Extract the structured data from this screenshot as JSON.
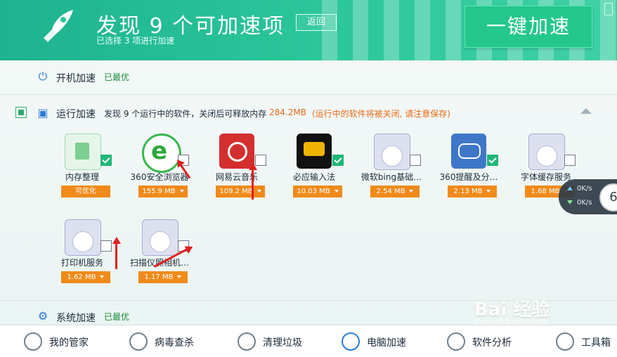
{
  "header": {
    "title": "发现 9 个可加速项",
    "subtitle": "已选择 3 项进行加速",
    "back_label": "返回",
    "accelerate_label": "一键加速"
  },
  "startup": {
    "title": "开机加速",
    "status": "已最优"
  },
  "running": {
    "title": "运行加速",
    "desc": "发现 9 个运行中的软件，关闭后可释放内存",
    "size": "284.2MB",
    "warning": "(运行中的软件将被关闭, 请注意保存)"
  },
  "apps": [
    {
      "label": "内存整理",
      "badge": "可优化",
      "checked": true,
      "icon": "memory-chip-icon"
    },
    {
      "label": "360安全浏览器",
      "badge": "155.9 MB",
      "checked": false,
      "icon": "ie-browser-icon"
    },
    {
      "label": "网易云音乐",
      "badge": "109.2 MB",
      "checked": false,
      "icon": "netease-music-icon"
    },
    {
      "label": "必应输入法",
      "badge": "10.03 MB",
      "checked": true,
      "icon": "bing-input-icon"
    },
    {
      "label": "微软bing基础…",
      "badge": "2.54 MB",
      "checked": false,
      "icon": "disc-service-icon"
    },
    {
      "label": "360提醒及分…",
      "badge": "2.13 MB",
      "checked": true,
      "icon": "chat-bubble-icon"
    },
    {
      "label": "字体缓存服务",
      "badge": "1.68 MB",
      "checked": false,
      "icon": "disc-service-icon"
    },
    {
      "label": "打印机服务",
      "badge": "1.62 MB",
      "checked": false,
      "icon": "disc-service-icon"
    },
    {
      "label": "扫描仪照相机…",
      "badge": "1.17 MB",
      "checked": false,
      "icon": "disc-service-icon"
    }
  ],
  "system": {
    "title": "系统加速",
    "status": "已最优"
  },
  "speed": {
    "upload": "0K/s",
    "download": "0K/s",
    "digit": "6"
  },
  "bottom_nav": [
    {
      "label": "我的管家",
      "icon": "user-icon"
    },
    {
      "label": "病毒查杀",
      "icon": "shield-icon"
    },
    {
      "label": "清理垃圾",
      "icon": "broom-icon"
    },
    {
      "label": "电脑加速",
      "icon": "rocket-icon"
    },
    {
      "label": "软件分析",
      "icon": "chart-icon"
    },
    {
      "label": "工具箱",
      "icon": "toolbox-icon"
    }
  ],
  "watermark": {
    "text": "Bai 经验",
    "url": "jingyan.baidu.com"
  }
}
